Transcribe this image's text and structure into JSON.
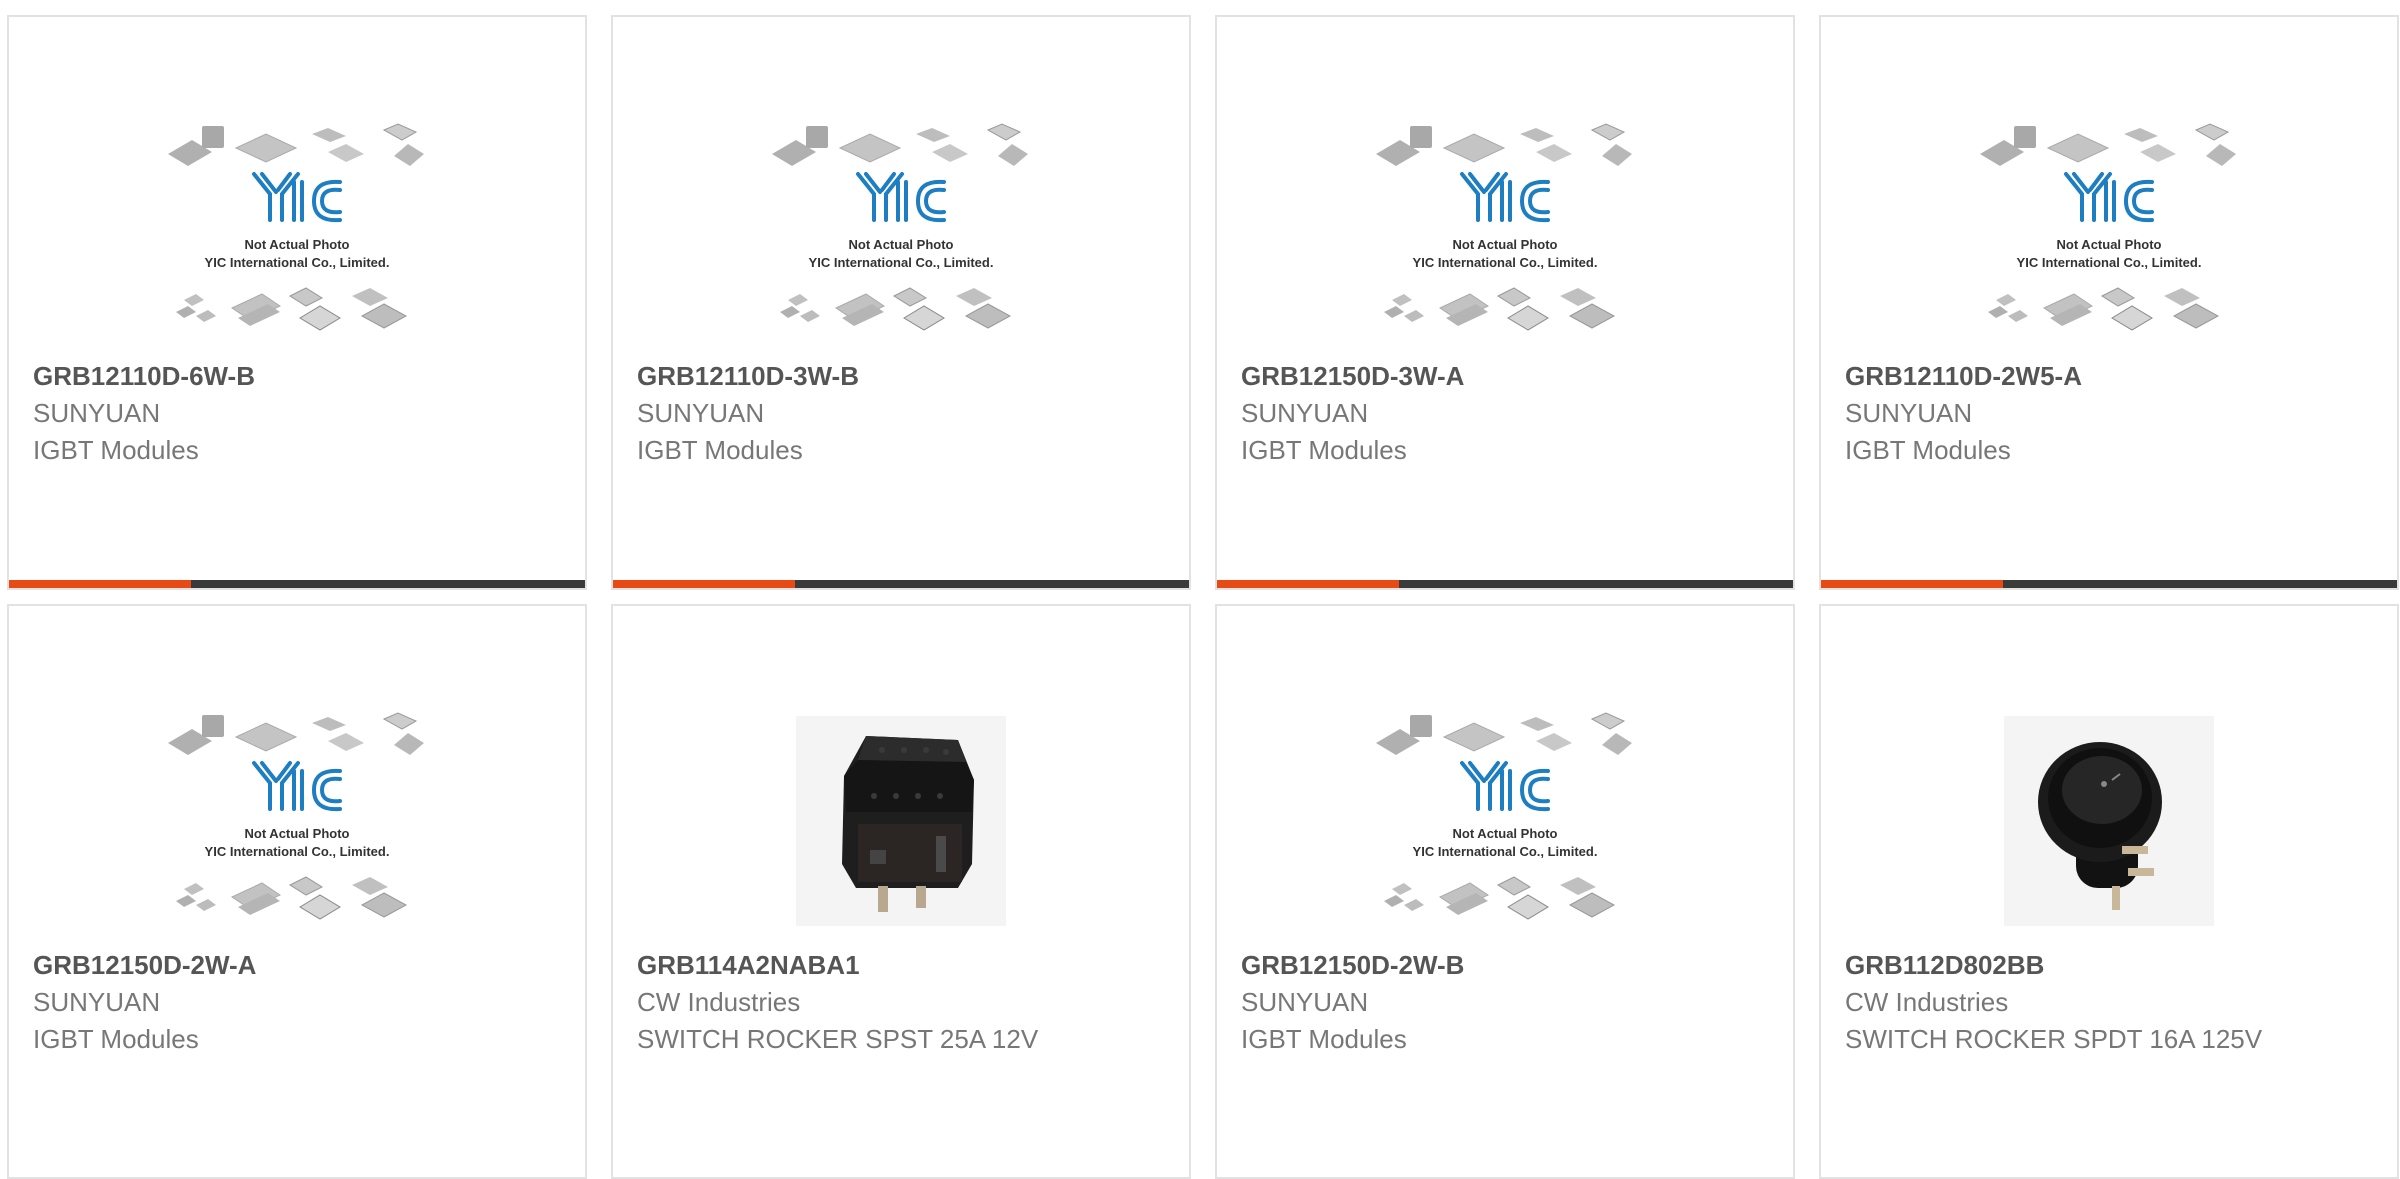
{
  "colors": {
    "accent": "#e84a16",
    "bar_dark": "#3a3a3a",
    "part_number": "#555555",
    "meta_text": "#777777",
    "yic_blue": "#1d7ec2"
  },
  "placeholder": {
    "logo_text": "YIC",
    "line1": "Not Actual Photo",
    "line2": "YIC International Co., Limited."
  },
  "products": [
    {
      "part_number": "GRB12110D-6W-B",
      "manufacturer": "SUNYUAN",
      "description": "IGBT Modules",
      "image": "placeholder",
      "active": true
    },
    {
      "part_number": "GRB12110D-3W-B",
      "manufacturer": "SUNYUAN",
      "description": "IGBT Modules",
      "image": "placeholder",
      "active": true
    },
    {
      "part_number": "GRB12150D-3W-A",
      "manufacturer": "SUNYUAN",
      "description": "IGBT Modules",
      "image": "placeholder",
      "active": true
    },
    {
      "part_number": "GRB12110D-2W5-A",
      "manufacturer": "SUNYUAN",
      "description": "IGBT Modules",
      "image": "placeholder",
      "active": true
    },
    {
      "part_number": "GRB12150D-2W-A",
      "manufacturer": "SUNYUAN",
      "description": "IGBT Modules",
      "image": "placeholder",
      "active": false
    },
    {
      "part_number": "GRB114A2NABA1",
      "manufacturer": "CW Industries",
      "description": "SWITCH ROCKER SPST 25A 12V",
      "image": "rocker-switch",
      "active": false
    },
    {
      "part_number": "GRB12150D-2W-B",
      "manufacturer": "SUNYUAN",
      "description": "IGBT Modules",
      "image": "placeholder",
      "active": false
    },
    {
      "part_number": "GRB112D802BB",
      "manufacturer": "CW Industries",
      "description": "SWITCH ROCKER SPDT 16A 125V",
      "image": "round-rocker-switch",
      "active": false
    }
  ]
}
